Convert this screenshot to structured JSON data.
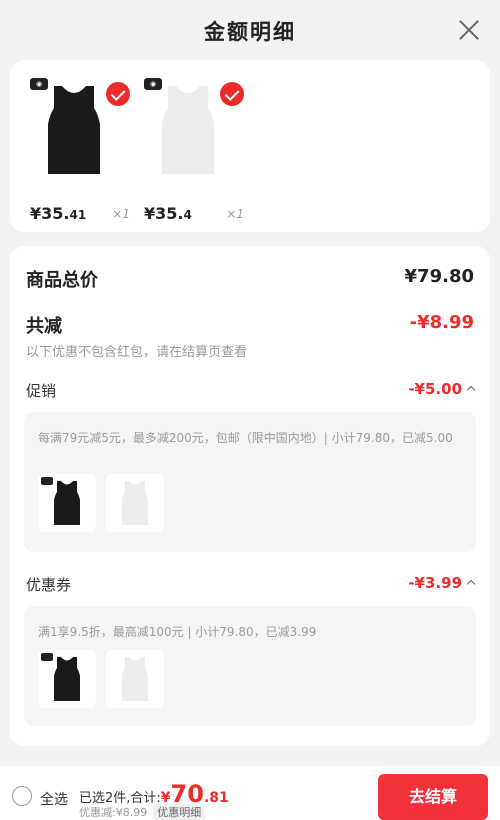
{
  "header": {
    "title": "金额明细"
  },
  "products": [
    {
      "price_main": "¥35.",
      "price_cents": "41",
      "qty": "×1",
      "color": "#1a1a1a"
    },
    {
      "price_main": "¥35.",
      "price_cents": "4",
      "qty": "×1",
      "color": "#ececec"
    }
  ],
  "detail": {
    "total_label": "商品总价",
    "total_value": "¥79.80",
    "discount_label": "共减",
    "discount_value": "-¥8.99",
    "discount_note": "以下优惠不包含红包，请在结算页查看",
    "promo": {
      "label": "促销",
      "value": "-¥5.00",
      "text": "每满79元减5元，最多减200元，包邮（限中国内地）| 小计79.80，已减5.00"
    },
    "coupon": {
      "label": "优惠券",
      "value": "-¥3.99",
      "text": "满1享9.5折，最高减100元 | 小计79.80，已减3.99"
    }
  },
  "footer": {
    "select_all": "全选",
    "summary": "已选2件,合计:",
    "currency": "¥",
    "total_int": "70",
    "total_dec": ".81",
    "discount_text": "优惠减:¥8.99",
    "detail_btn": "优惠明细",
    "checkout_label": "去结算"
  },
  "colors": {
    "accent": "#ee2b2b",
    "button": "#f2313a"
  }
}
